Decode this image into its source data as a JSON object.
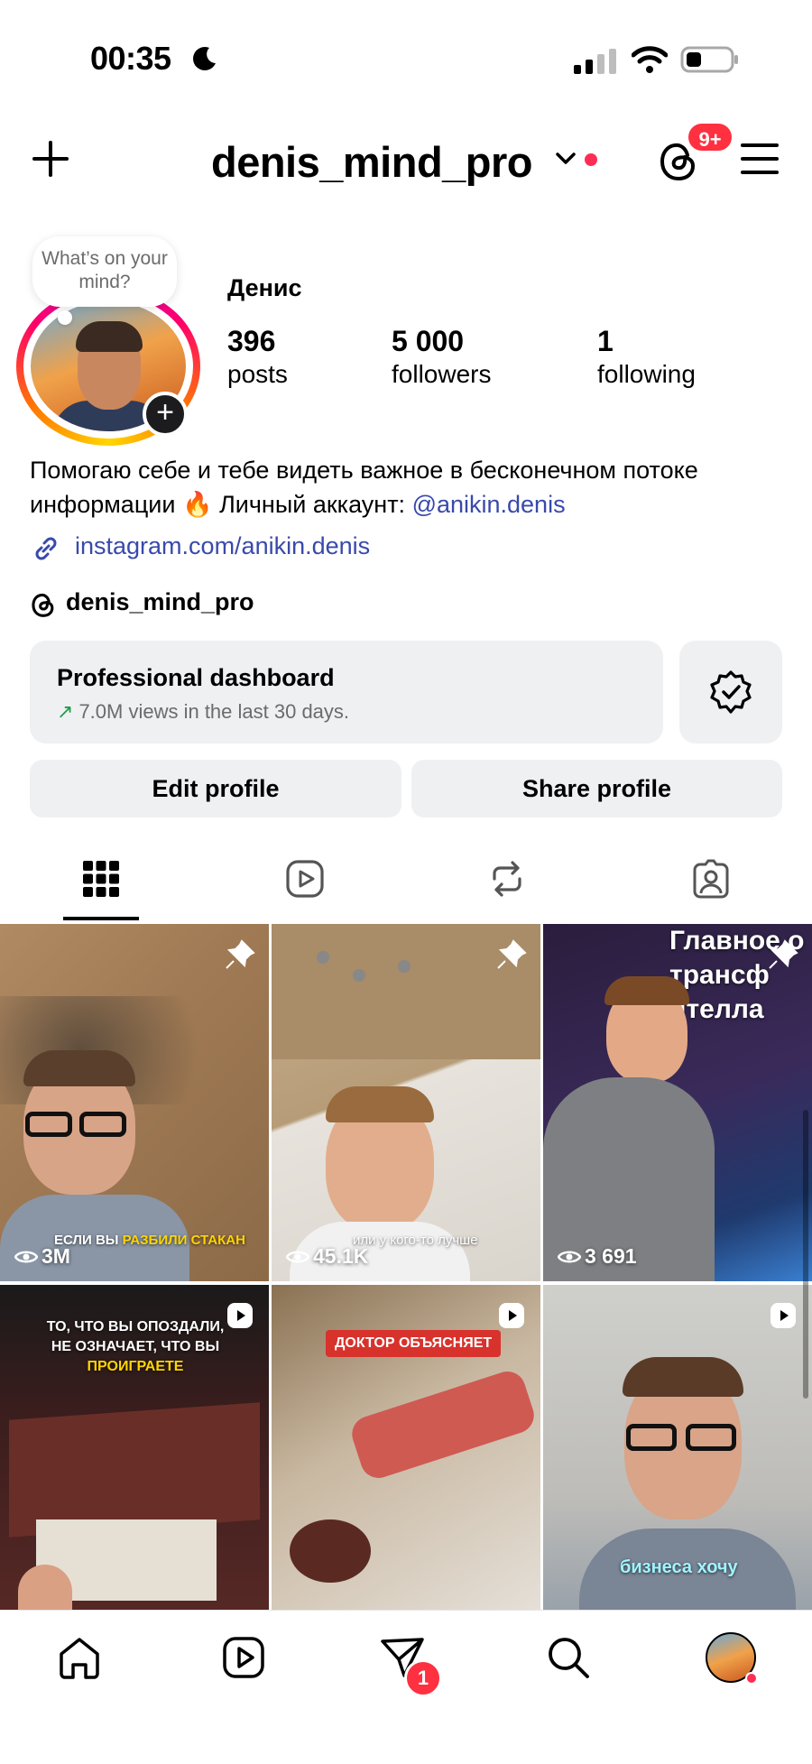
{
  "status_bar": {
    "time": "00:35"
  },
  "header": {
    "username": "denis_mind_pro",
    "notifications_badge": "9+"
  },
  "profile": {
    "thought_bubble": "What’s on your mind?",
    "display_name": "Денис",
    "stats": [
      {
        "value": "396",
        "label": "posts"
      },
      {
        "value": "5 000",
        "label": "followers"
      },
      {
        "value": "1",
        "label": "following"
      }
    ],
    "bio_text": "Помогаю себе и тебе видеть важное в бесконечном потоке информации 🔥 Личный аккаунт: ",
    "bio_mention": "@anikin.denis",
    "link": "instagram.com/anikin.denis",
    "threads_handle": "denis_mind_pro"
  },
  "dashboard": {
    "title": "Professional dashboard",
    "subtitle_arrow": "↗",
    "subtitle": "7.0M views in the last 30 days."
  },
  "actions": {
    "edit": "Edit profile",
    "share": "Share profile"
  },
  "tabs": [
    "grid-icon",
    "reels-icon",
    "reposts-icon",
    "tagged-icon"
  ],
  "grid": [
    {
      "views": "3M",
      "caption_pre": "ЕСЛИ ВЫ ",
      "caption_hl": "РАЗБИЛИ СТАКАН",
      "pinned": true
    },
    {
      "views": "45.1K",
      "caption": "или у кого-то лучше",
      "pinned": true
    },
    {
      "views": "3 691",
      "overlay": "Главное о трансф ителла",
      "pinned": true
    },
    {
      "caption_top_1": "ТО, ЧТО ВЫ ОПОЗДАЛИ,",
      "caption_top_2_pre": "НЕ ОЗНАЧАЕТ, ЧТО ВЫ ",
      "caption_top_2_hl": "ПРОИГРАЕТЕ",
      "type": "reel"
    },
    {
      "label": "ДОКТОР ОБЪЯСНЯЕТ",
      "type": "reel"
    },
    {
      "caption": "бизнеса хочу",
      "type": "reel"
    }
  ],
  "bottom_nav": {
    "messages_badge": "1"
  },
  "colors": {
    "accent_link": "#3949ab",
    "badge_red": "#ff3040",
    "button_bg": "#eff0f2"
  }
}
